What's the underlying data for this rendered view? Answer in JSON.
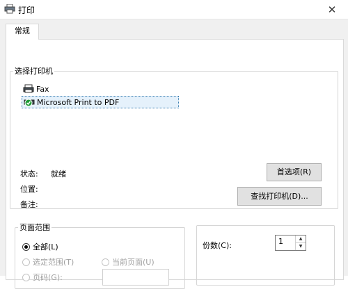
{
  "window": {
    "title": "打印",
    "close": "✕"
  },
  "tabs": [
    {
      "label": "常规"
    }
  ],
  "select_printer": {
    "label": "选择打印机",
    "printers": [
      {
        "name": "Fax",
        "icon": "fax-printer-icon"
      },
      {
        "name": "Microsoft Print to PDF",
        "icon": "pdf-printer-default-icon"
      }
    ]
  },
  "status": {
    "label": "状态:",
    "value": "就绪"
  },
  "location": {
    "label": "位置:",
    "value": ""
  },
  "comment": {
    "label": "备注:",
    "value": ""
  },
  "buttons": {
    "preferences": "首选项(R)",
    "find_printer": "查找打印机(D)..."
  },
  "page_range": {
    "label": "页面范围",
    "all": "全部(L)",
    "selection": "选定范围(T)",
    "current_page": "当前页面(U)",
    "pages": "页码(G):"
  },
  "copies": {
    "label": "份数(C):",
    "value": "1"
  },
  "colors": {
    "accent": "#3c7fb1",
    "check_green": "#1e9b37"
  }
}
